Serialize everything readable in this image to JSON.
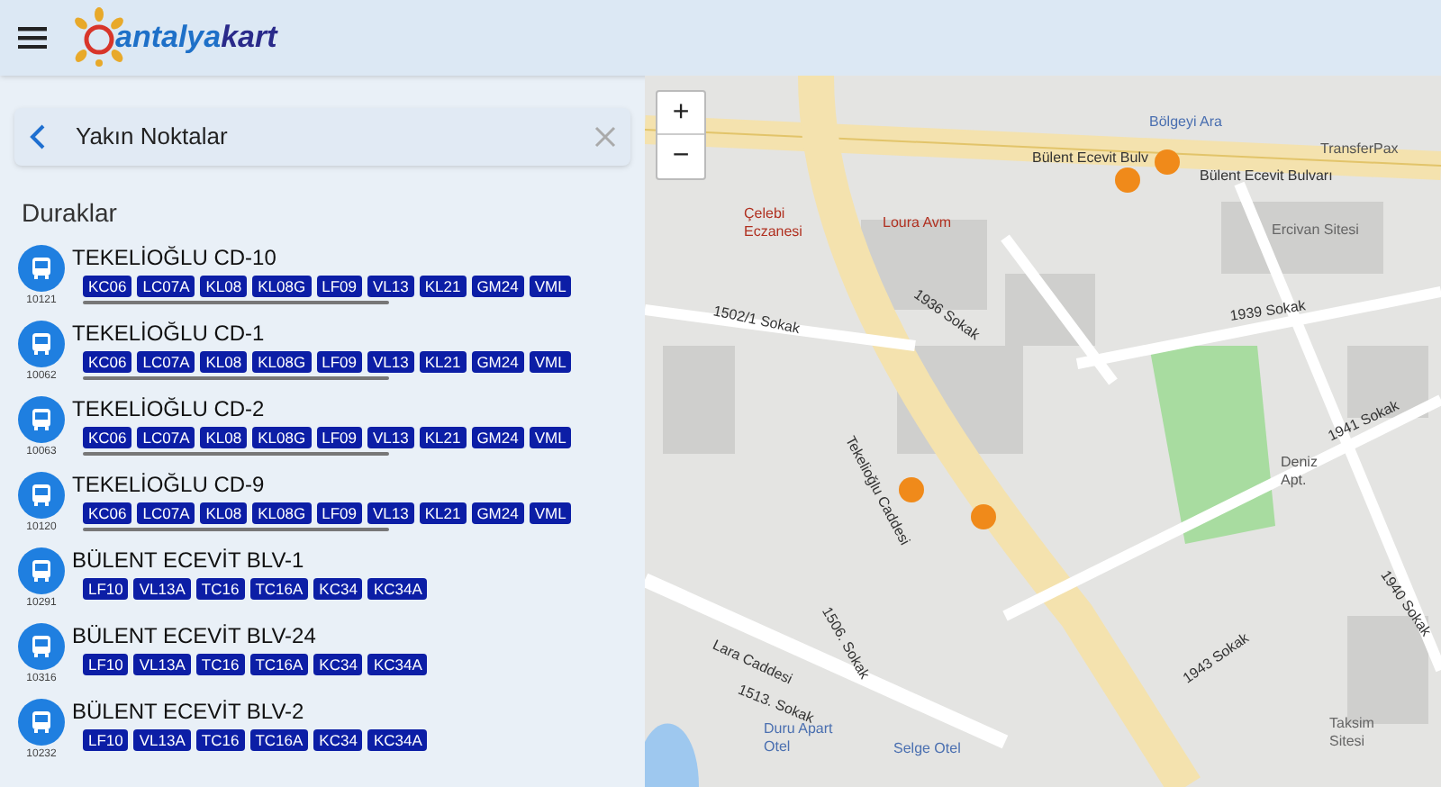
{
  "header": {
    "logo_prefix": "antalya",
    "logo_suffix": "kart"
  },
  "search": {
    "value": "Yakın Noktalar"
  },
  "section_title": "Duraklar",
  "stops": [
    {
      "name": "TEKELİOĞLU CD-10",
      "code": "10121",
      "routes": [
        "KC06",
        "LC07A",
        "KL08",
        "KL08G",
        "LF09",
        "VL13",
        "KL21",
        "GM24",
        "VML"
      ]
    },
    {
      "name": "TEKELİOĞLU CD-1",
      "code": "10062",
      "routes": [
        "KC06",
        "LC07A",
        "KL08",
        "KL08G",
        "LF09",
        "VL13",
        "KL21",
        "GM24",
        "VML"
      ]
    },
    {
      "name": "TEKELİOĞLU CD-2",
      "code": "10063",
      "routes": [
        "KC06",
        "LC07A",
        "KL08",
        "KL08G",
        "LF09",
        "VL13",
        "KL21",
        "GM24",
        "VML"
      ]
    },
    {
      "name": "TEKELİOĞLU CD-9",
      "code": "10120",
      "routes": [
        "KC06",
        "LC07A",
        "KL08",
        "KL08G",
        "LF09",
        "VL13",
        "KL21",
        "GM24",
        "VML"
      ]
    },
    {
      "name": "BÜLENT ECEVİT BLV-1",
      "code": "10291",
      "routes": [
        "LF10",
        "VL13A",
        "TC16",
        "TC16A",
        "KC34",
        "KC34A"
      ]
    },
    {
      "name": "BÜLENT ECEVİT BLV-24",
      "code": "10316",
      "routes": [
        "LF10",
        "VL13A",
        "TC16",
        "TC16A",
        "KC34",
        "KC34A"
      ]
    },
    {
      "name": "BÜLENT ECEVİT BLV-2",
      "code": "10232",
      "routes": [
        "LF10",
        "VL13A",
        "TC16",
        "TC16A",
        "KC34",
        "KC34A"
      ]
    }
  ],
  "map": {
    "zoom_in": "+",
    "zoom_out": "−",
    "labels": [
      "Bülent Ecevit Bulvarı",
      "Bülent Ecevit Bulv",
      "Bölgeyi Ara",
      "TransferPax",
      "Çelebi Eczanesi",
      "Loura Avm",
      "Ercivan Sitesi",
      "1936 Sokak",
      "1939 Sokak",
      "1502/1 Sokak",
      "Tekelioğlu Caddesi",
      "Deniz Apt.",
      "1941 Sokak",
      "1940 Sokak",
      "1943 Sokak",
      "Lara Caddesi",
      "1513. Sokak",
      "1506. Sokak",
      "Duru Apart Otel",
      "Selge Otel",
      "Taksim Sitesi"
    ]
  }
}
